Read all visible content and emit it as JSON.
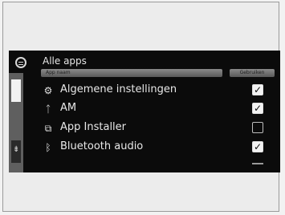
{
  "screen": {
    "title": "Alle apps",
    "columns": {
      "name_header": "App naam",
      "enabled_header": "Gebruiken"
    },
    "items": [
      {
        "label": "Algemene instellingen",
        "icon": "gear-icon",
        "glyph": "⚙",
        "checked": true,
        "mark": "✓"
      },
      {
        "label": "AM",
        "icon": "radio-antenna-icon",
        "glyph": "ᛏ",
        "checked": true,
        "mark": "✓"
      },
      {
        "label": "App Installer",
        "icon": "app-installer-icon",
        "glyph": "⧉",
        "checked": false,
        "mark": ""
      },
      {
        "label": "Bluetooth audio",
        "icon": "bluetooth-icon",
        "glyph": "ᛒ",
        "checked": true,
        "mark": "✓"
      }
    ],
    "scroll_down_glyph": "⇟"
  }
}
